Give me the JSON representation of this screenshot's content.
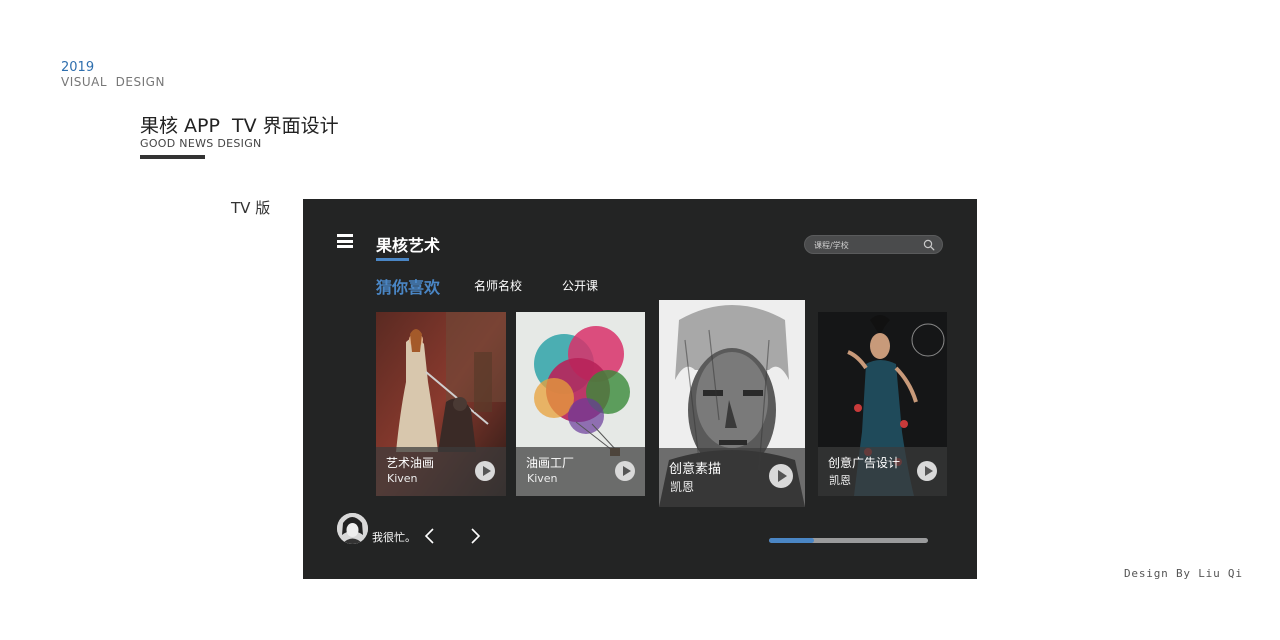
{
  "header": {
    "year": "2019",
    "visual_design": "VISUAL  DESIGN",
    "title": "果核 APP  TV 界面设计",
    "subtitle": "GOOD NEWS DESIGN",
    "tv_label": "TV 版"
  },
  "footer": {
    "credit": "Design By Liu Qi"
  },
  "tv": {
    "menu_icon": "hamburger-menu-icon",
    "app_title": "果核艺术",
    "search": {
      "placeholder": "课程/学校",
      "icon": "search-icon"
    },
    "tabs": [
      {
        "label": "猜你喜欢",
        "active": true
      },
      {
        "label": "名师名校",
        "active": false
      },
      {
        "label": "公开课",
        "active": false
      }
    ],
    "cards": [
      {
        "title": "艺术油画",
        "author": "Kiven"
      },
      {
        "title": "油画工厂",
        "author": "Kiven"
      },
      {
        "title": "创意素描",
        "author": "凯恩",
        "focused": true
      },
      {
        "title": "创意广告设计",
        "author": "凯恩"
      }
    ],
    "user": {
      "status": "我很忙。"
    },
    "progress": {
      "fraction": 0.28
    },
    "colors": {
      "accent": "#4a86c5",
      "panel_bg": "#232424"
    }
  }
}
